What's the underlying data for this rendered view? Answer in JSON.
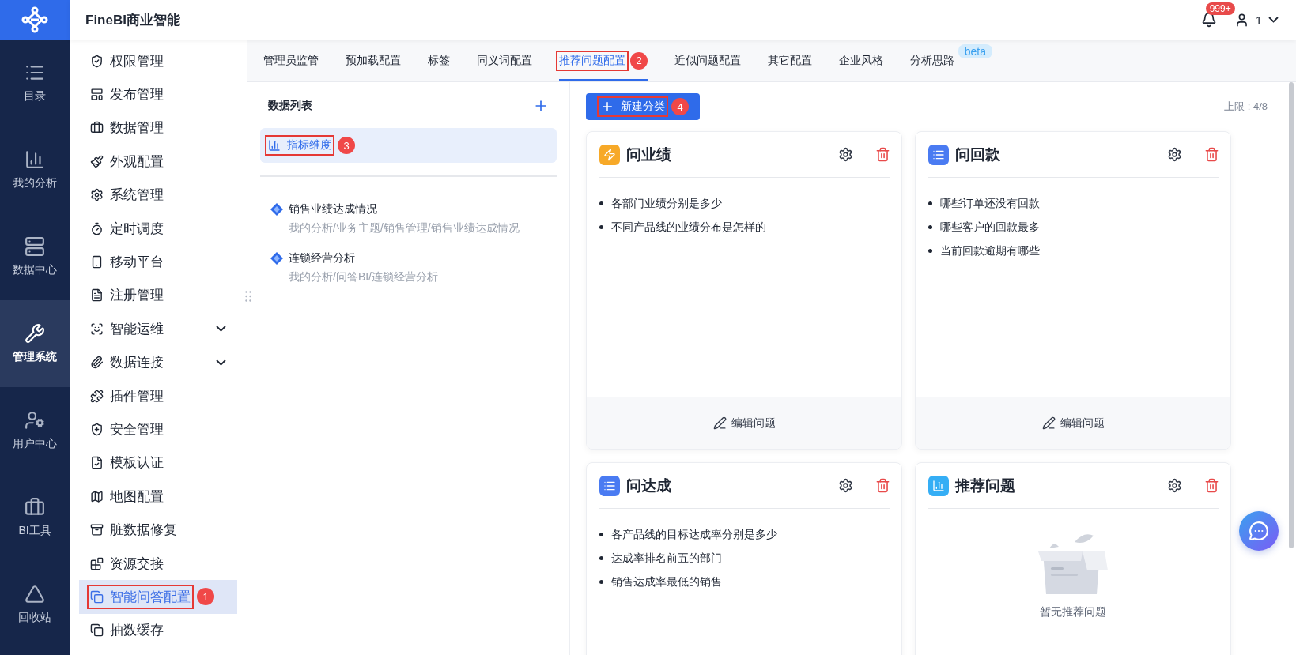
{
  "app": {
    "title": "FineBI商业智能"
  },
  "header": {
    "notification_badge": "999+",
    "user": "1"
  },
  "rail": [
    {
      "label": "目录",
      "selected": false
    },
    {
      "label": "我的分析",
      "selected": false
    },
    {
      "label": "数据中心",
      "selected": false
    },
    {
      "label": "管理系统",
      "selected": true
    },
    {
      "label": "用户中心",
      "selected": false
    },
    {
      "label": "BI工具",
      "selected": false
    },
    {
      "label": "回收站",
      "selected": false
    }
  ],
  "sidebar": [
    {
      "label": "权限管理",
      "selected": false
    },
    {
      "label": "发布管理",
      "selected": false
    },
    {
      "label": "数据管理",
      "selected": false
    },
    {
      "label": "外观配置",
      "selected": false
    },
    {
      "label": "系统管理",
      "selected": false
    },
    {
      "label": "定时调度",
      "selected": false
    },
    {
      "label": "移动平台",
      "selected": false
    },
    {
      "label": "注册管理",
      "selected": false
    },
    {
      "label": "智能运维",
      "selected": false,
      "expanded": false
    },
    {
      "label": "数据连接",
      "selected": false,
      "expanded": false
    },
    {
      "label": "插件管理",
      "selected": false
    },
    {
      "label": "安全管理",
      "selected": false
    },
    {
      "label": "模板认证",
      "selected": false
    },
    {
      "label": "地图配置",
      "selected": false
    },
    {
      "label": "脏数据修复",
      "selected": false
    },
    {
      "label": "资源交接",
      "selected": false
    },
    {
      "label": "智能问答配置",
      "selected": true,
      "callout": "1"
    },
    {
      "label": "抽数缓存",
      "selected": false
    }
  ],
  "tabs": [
    {
      "label": "管理员监管",
      "selected": false
    },
    {
      "label": "预加载配置",
      "selected": false
    },
    {
      "label": "标签",
      "selected": false
    },
    {
      "label": "同义词配置",
      "selected": false
    },
    {
      "label": "推荐问题配置",
      "selected": true,
      "callout": "2"
    },
    {
      "label": "近似问题配置",
      "selected": false
    },
    {
      "label": "其它配置",
      "selected": false
    },
    {
      "label": "企业风格",
      "selected": false
    },
    {
      "label": "分析思路",
      "selected": false,
      "badge": "beta"
    }
  ],
  "data_list": {
    "title": "数据列表",
    "items": [
      {
        "label": "指标维度",
        "selected": true,
        "callout": "3"
      }
    ],
    "analyses": [
      {
        "name": "销售业绩达成情况",
        "path": "我的分析/业务主题/销售管理/销售业绩达成情况"
      },
      {
        "name": "连锁经营分析",
        "path": "我的分析/问答BI/连锁经营分析"
      }
    ]
  },
  "toolbar": {
    "new_button": {
      "label": "新建分类",
      "callout": "4"
    },
    "limit": "上限 : 4/8"
  },
  "cards": [
    {
      "title": "问业绩",
      "kind": "orange",
      "questions": [
        "各部门业绩分别是多少",
        "不同产品线的业绩分布是怎样的"
      ],
      "footer": "编辑问题"
    },
    {
      "title": "问回款",
      "kind": "blue",
      "questions": [
        "哪些订单还没有回款",
        "哪些客户的回款最多",
        "当前回款逾期有哪些"
      ],
      "footer": "编辑问题"
    },
    {
      "title": "问达成",
      "kind": "blue",
      "questions": [
        "各产品线的目标达成率分别是多少",
        "达成率排名前五的部门",
        "销售达成率最低的销售"
      ]
    },
    {
      "title": "推荐问题",
      "kind": "cyan",
      "empty": "暂无推荐问题"
    }
  ]
}
